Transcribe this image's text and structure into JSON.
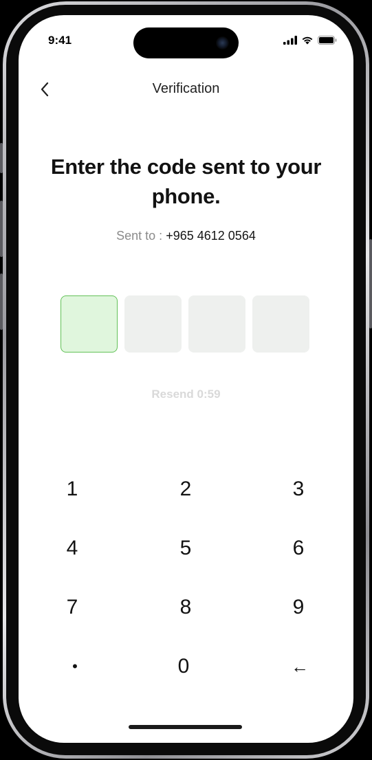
{
  "status_bar": {
    "time": "9:41",
    "icons": [
      "cellular-signal-icon",
      "wifi-icon",
      "battery-icon"
    ]
  },
  "nav": {
    "back_icon": "chevron-left-icon",
    "title": "Verification"
  },
  "headline": "Enter the code sent to your phone.",
  "sent_to": {
    "label": "Sent to :",
    "phone": "+965 4612 0564"
  },
  "code": {
    "length": 4,
    "active_index": 0,
    "digits": [
      "",
      "",
      "",
      ""
    ]
  },
  "resend": {
    "label": "Resend 0:59"
  },
  "keypad": {
    "keys": [
      "1",
      "2",
      "3",
      "4",
      "5",
      "6",
      "7",
      "8",
      "9",
      "•",
      "0",
      "←"
    ]
  },
  "colors": {
    "active_box_bg": "#e0f6dd",
    "active_box_border": "#62c157",
    "inactive_box_bg": "#eef0ee",
    "resend_disabled": "#d9d9d9"
  }
}
